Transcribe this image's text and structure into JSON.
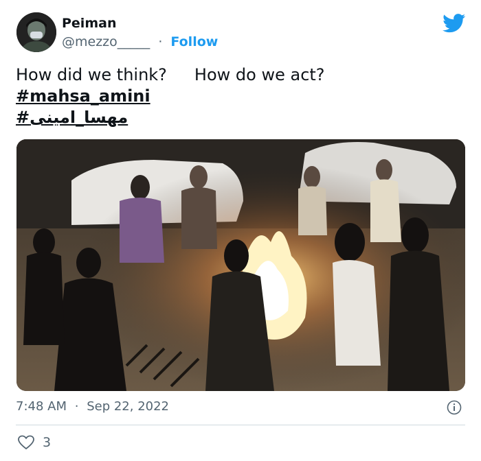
{
  "user": {
    "name": "Peiman",
    "handle": "@mezzo_____",
    "separator": "·",
    "follow_label": "Follow"
  },
  "tweet": {
    "text_part1": "How did we think?",
    "text_part2": "How do we act?",
    "hashtags": [
      "#mahsa_amini",
      "#مهسا_امینی"
    ]
  },
  "meta": {
    "time": "7:48 AM",
    "separator": "·",
    "date": "Sep 22, 2022"
  },
  "engagement": {
    "likes": "3"
  },
  "icons": {
    "brand": "twitter-bird-icon",
    "info": "info-icon",
    "like": "heart-icon"
  },
  "colors": {
    "accent": "#1d9bf0",
    "text": "#0f1419",
    "muted": "#536471",
    "divider": "#cfd9de"
  }
}
